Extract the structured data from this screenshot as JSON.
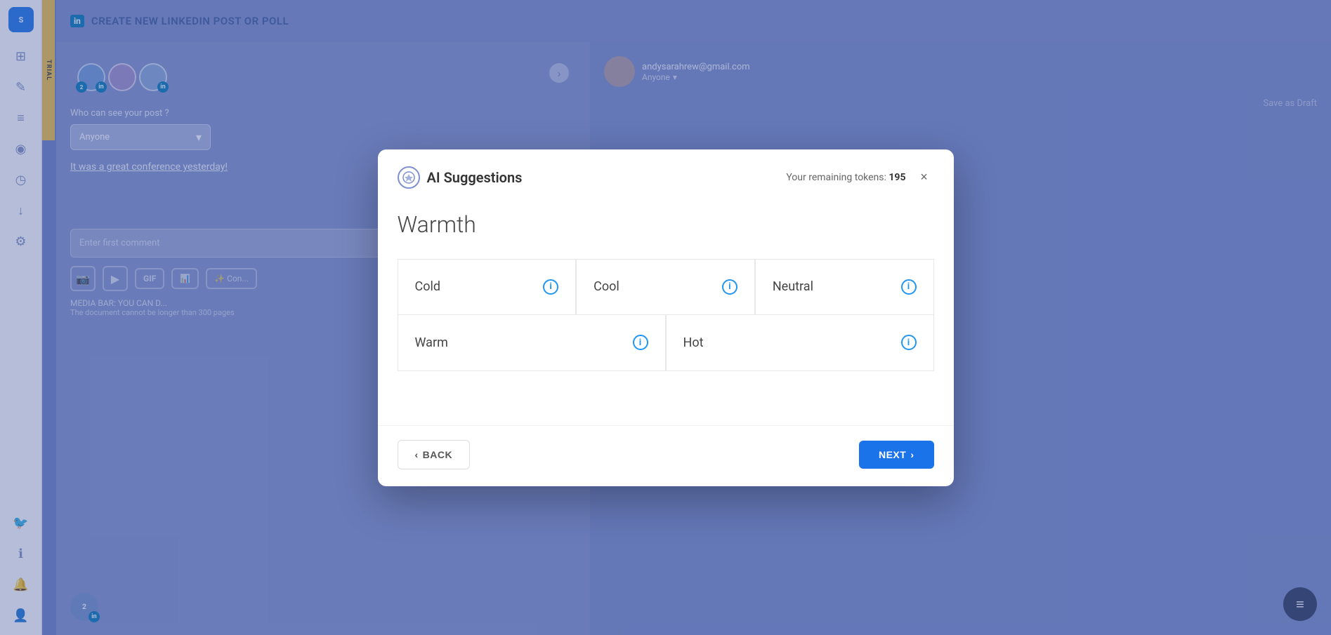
{
  "app": {
    "title": "CREATE NEW LINKEDIN POST OR POLL",
    "trial_badge": "TRIAL"
  },
  "sidebar": {
    "logo": "S",
    "icons": [
      "grid",
      "edit",
      "list",
      "rss",
      "clock",
      "download",
      "gear",
      "twitter",
      "info",
      "bell",
      "user"
    ]
  },
  "background": {
    "post_text": "It was a great conference yesterday!",
    "who_can_see": "Who can see your post ?",
    "anyone_label": "Anyone",
    "comment_placeholder": "Enter first comment",
    "media_bar_text": "MEDIA BAR: YOU CAN D...",
    "doc_limit": "The document cannot be longer than 300 pages",
    "right_email": "andysarahrew@gmail.com",
    "right_anyone": "Anyone"
  },
  "modal": {
    "ai_icon": "✦",
    "title": "AI Suggestions",
    "tokens_label": "Your remaining tokens:",
    "tokens_count": "195",
    "close_label": "×",
    "section_title": "Warmth",
    "options": [
      {
        "id": "cold",
        "label": "Cold",
        "info": "i"
      },
      {
        "id": "cool",
        "label": "Cool",
        "info": "i"
      },
      {
        "id": "neutral",
        "label": "Neutral",
        "info": "i"
      },
      {
        "id": "warm",
        "label": "Warm",
        "info": "i"
      },
      {
        "id": "hot",
        "label": "Hot",
        "info": "i"
      }
    ],
    "back_label": "BACK",
    "next_label": "NEXT"
  }
}
